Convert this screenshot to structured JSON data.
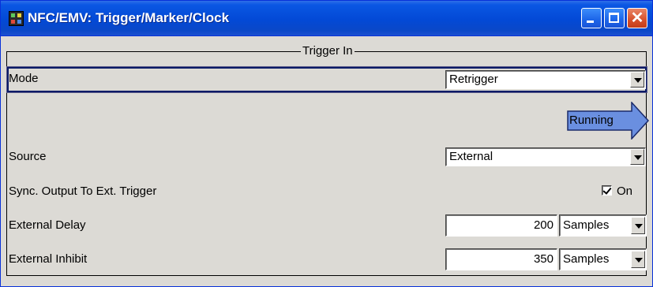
{
  "window": {
    "title": "NFC/EMV: Trigger/Marker/Clock",
    "colors": {
      "title_bar": "#0349d6",
      "running_arrow": "#6a8fe0",
      "close_button": "#d6502b"
    }
  },
  "trigger_in": {
    "group_title": "Trigger In",
    "mode": {
      "label": "Mode",
      "value": "Retrigger"
    },
    "status": {
      "label": "Running"
    },
    "source": {
      "label": "Source",
      "value": "External"
    },
    "sync_output": {
      "label": "Sync. Output To Ext. Trigger",
      "checked": true,
      "state_label": "On"
    },
    "external_delay": {
      "label": "External Delay",
      "value": "200",
      "unit": "Samples"
    },
    "external_inhibit": {
      "label": "External Inhibit",
      "value": "350",
      "unit": "Samples"
    }
  },
  "icons": {
    "app": "instrument-app-icon",
    "minimize": "minimize-icon",
    "maximize": "maximize-icon",
    "close": "close-icon",
    "dropdown": "chevron-down-icon",
    "running": "right-arrow-icon",
    "checkbox": "checkmark-icon"
  }
}
